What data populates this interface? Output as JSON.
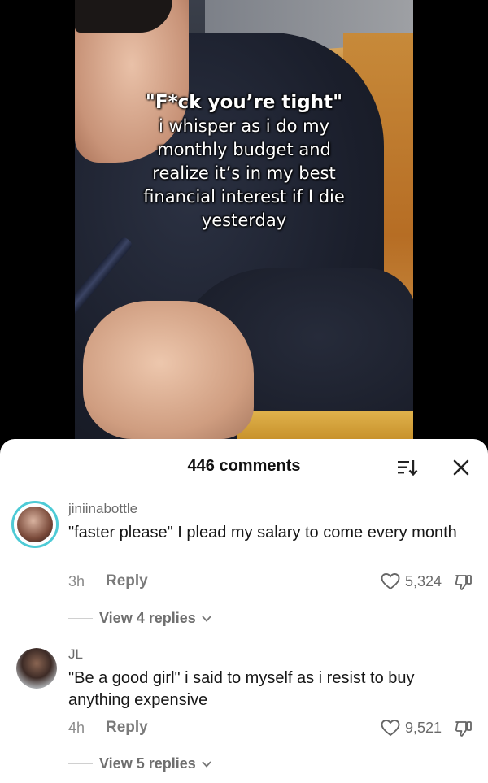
{
  "video": {
    "caption_title": "\"F*ck you’re tight\"",
    "caption_body": "i whisper as i do my\nmonthly budget and\nrealize it’s in my best\nfinancial interest if I die\nyesterday"
  },
  "comments_sheet": {
    "count_label": "446 comments",
    "sort_icon": "sort-icon",
    "close_icon": "close-icon",
    "comments": [
      {
        "username": "jiniinabottle",
        "text": "\"faster please\" I plead my salary to come every month",
        "time": "3h",
        "reply_label": "Reply",
        "likes": "5,324",
        "view_replies": "View 4 replies"
      },
      {
        "username": "JL",
        "text": "\"Be a good girl\" i said to myself as i resist to buy anything expensive",
        "time": "4h",
        "reply_label": "Reply",
        "likes": "9,521",
        "view_replies": "View 5 replies"
      }
    ]
  },
  "colors": {
    "avatar_ring": "#4ecbd6",
    "sheet_bg": "#ffffff",
    "text": "#161616",
    "muted": "#8a8a8a"
  }
}
